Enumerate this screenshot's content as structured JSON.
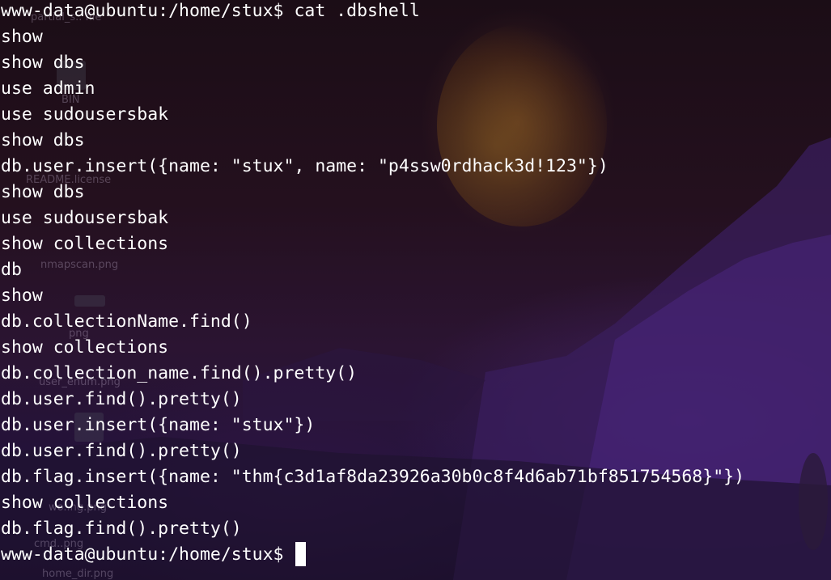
{
  "terminal": {
    "prompt": "www-data@ubuntu:/home/stux$ ",
    "command": "cat .dbshell",
    "output_lines": [
      "show",
      "show dbs",
      "use admin",
      "use sudousersbak",
      "show dbs",
      "db.user.insert({name: \"stux\", name: \"p4ssw0rdhack3d!123\"})",
      "show dbs",
      "use sudousersbak",
      "show collections",
      "db",
      "show",
      "db.collectionName.find()",
      "show collections",
      "db.collection_name.find().pretty()",
      "db.user.find().pretty()",
      "db.user.insert({name: \"stux\"})",
      "db.user.find().pretty()",
      "db.flag.insert({name: \"thm{c3d1af8da23926a30b0c8f4d6ab71bf851754568}\"})",
      "show collections",
      "db.flag.find().pretty()"
    ],
    "final_prompt": "www-data@ubuntu:/home/stux$ ",
    "text_color": "#ffffff"
  },
  "desktop": {
    "icons": [
      {
        "name": "partial-file-icon",
        "label": "partial_s.. file"
      },
      {
        "name": "bin-file-icon",
        "label": "BIN"
      },
      {
        "name": "readme-icon",
        "label": "README.license"
      },
      {
        "name": "nmapscan-icon",
        "label": "nmapscan.png"
      },
      {
        "name": "png-file-icon",
        "label": "png"
      },
      {
        "name": "user-enum-icon",
        "label": "user_enum.png"
      },
      {
        "name": "sh-file-icon",
        "label": "sh"
      },
      {
        "name": "wo-png-icon",
        "label": "wo..ng.png"
      },
      {
        "name": "cmd-png-icon",
        "label": "cmd..png"
      },
      {
        "name": "home-dir-icon",
        "label": "home_dir.png"
      }
    ]
  }
}
